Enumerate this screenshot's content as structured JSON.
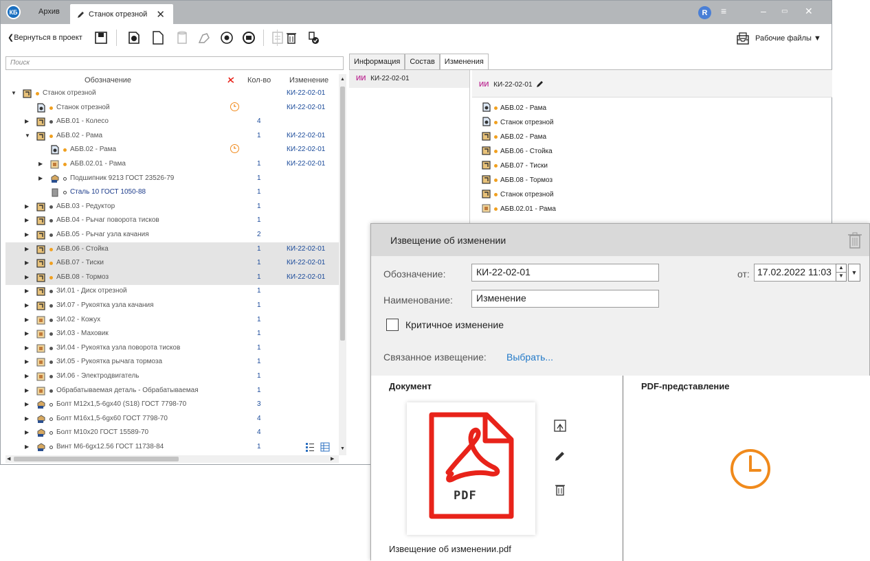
{
  "window": {
    "logo": "КБ",
    "tabs": [
      "Архив",
      "Станок отрезной"
    ],
    "user_initial": "R",
    "buttons": [
      "menu-icon",
      "minimize-icon",
      "restore-icon",
      "close-icon"
    ]
  },
  "toolbar": {
    "back_label": "Вернуться в проект",
    "workfiles_label": "Рабочие файлы ▼"
  },
  "left": {
    "search_placeholder": "Поиск",
    "columns": {
      "designation": "Обозначение",
      "qty": "Кол-во",
      "change": "Изменение"
    },
    "rows": [
      {
        "level": 0,
        "exp": "▼",
        "icon": "assembly",
        "dot": "#f0a020",
        "name": "Станок отрезной",
        "qty": "",
        "change": "КИ-22-02-01",
        "hl": false,
        "clock": false
      },
      {
        "level": 1,
        "exp": "",
        "icon": "drawing",
        "dot": "#f0a020",
        "name": "Станок отрезной",
        "qty": "",
        "change": "КИ-22-02-01",
        "hl": false,
        "clock": true
      },
      {
        "level": 1,
        "exp": "▶",
        "icon": "assembly",
        "dot": "#555",
        "name": "АБВ.01 - Колесо",
        "qty": "4",
        "change": "",
        "hl": false,
        "clock": false
      },
      {
        "level": 1,
        "exp": "▼",
        "icon": "assembly",
        "dot": "#f0a020",
        "name": "АБВ.02 - Рама",
        "qty": "1",
        "change": "КИ-22-02-01",
        "hl": false,
        "clock": false
      },
      {
        "level": 2,
        "exp": "",
        "icon": "drawing",
        "dot": "#f0a020",
        "name": "АБВ.02 - Рама",
        "qty": "",
        "change": "КИ-22-02-01",
        "hl": false,
        "clock": true
      },
      {
        "level": 2,
        "exp": "▶",
        "icon": "part",
        "dot": "#f0a020",
        "name": "АБВ.02.01 - Рама",
        "qty": "1",
        "change": "КИ-22-02-01",
        "hl": false,
        "clock": false
      },
      {
        "level": 2,
        "exp": "▶",
        "icon": "standard",
        "dot": "ring",
        "name": "Подшипник 9213 ГОСТ 23526-79",
        "qty": "1",
        "change": "",
        "hl": false,
        "clock": false
      },
      {
        "level": 2,
        "exp": "",
        "icon": "material",
        "dot": "ring",
        "name": "Сталь 10 ГОСТ 1050-88",
        "qty": "1",
        "change": "",
        "hl": false,
        "clock": false,
        "blue": true
      },
      {
        "level": 1,
        "exp": "▶",
        "icon": "assembly",
        "dot": "#555",
        "name": "АБВ.03 - Редуктор",
        "qty": "1",
        "change": "",
        "hl": false,
        "clock": false
      },
      {
        "level": 1,
        "exp": "▶",
        "icon": "assembly",
        "dot": "#555",
        "name": "АБВ.04 - Рычаг поворота тисков",
        "qty": "1",
        "change": "",
        "hl": false,
        "clock": false
      },
      {
        "level": 1,
        "exp": "▶",
        "icon": "assembly",
        "dot": "#555",
        "name": "АБВ.05 - Рычаг узла качания",
        "qty": "2",
        "change": "",
        "hl": false,
        "clock": false
      },
      {
        "level": 1,
        "exp": "▶",
        "icon": "assembly",
        "dot": "#f0a020",
        "name": "АБВ.06 - Стойка",
        "qty": "1",
        "change": "КИ-22-02-01",
        "hl": true,
        "clock": false
      },
      {
        "level": 1,
        "exp": "▶",
        "icon": "assembly",
        "dot": "#f0a020",
        "name": "АБВ.07 - Тиски",
        "qty": "1",
        "change": "КИ-22-02-01",
        "hl": true,
        "clock": false
      },
      {
        "level": 1,
        "exp": "▶",
        "icon": "assembly",
        "dot": "#f0a020",
        "name": "АБВ.08 - Тормоз",
        "qty": "1",
        "change": "КИ-22-02-01",
        "hl": true,
        "clock": false
      },
      {
        "level": 1,
        "exp": "▶",
        "icon": "assembly",
        "dot": "#555",
        "name": "ЗИ.01 - Диск отрезной",
        "qty": "1",
        "change": "",
        "hl": false,
        "clock": false
      },
      {
        "level": 1,
        "exp": "▶",
        "icon": "assembly",
        "dot": "#555",
        "name": "ЗИ.07 - Рукоятка узла качания",
        "qty": "1",
        "change": "",
        "hl": false,
        "clock": false
      },
      {
        "level": 1,
        "exp": "▶",
        "icon": "part",
        "dot": "#555",
        "name": "ЗИ.02 - Кожух",
        "qty": "1",
        "change": "",
        "hl": false,
        "clock": false
      },
      {
        "level": 1,
        "exp": "▶",
        "icon": "part",
        "dot": "#555",
        "name": "ЗИ.03 - Маховик",
        "qty": "1",
        "change": "",
        "hl": false,
        "clock": false
      },
      {
        "level": 1,
        "exp": "▶",
        "icon": "part",
        "dot": "#555",
        "name": "ЗИ.04 - Рукоятка узла поворота тисков",
        "qty": "1",
        "change": "",
        "hl": false,
        "clock": false
      },
      {
        "level": 1,
        "exp": "▶",
        "icon": "part",
        "dot": "#555",
        "name": "ЗИ.05 - Рукоятка рычага тормоза",
        "qty": "1",
        "change": "",
        "hl": false,
        "clock": false
      },
      {
        "level": 1,
        "exp": "▶",
        "icon": "part",
        "dot": "#555",
        "name": "ЗИ.06 - Электродвигатель",
        "qty": "1",
        "change": "",
        "hl": false,
        "clock": false
      },
      {
        "level": 1,
        "exp": "▶",
        "icon": "part",
        "dot": "#555",
        "name": "Обрабатываемая деталь - Обрабатываемая",
        "qty": "1",
        "change": "",
        "hl": false,
        "clock": false
      },
      {
        "level": 1,
        "exp": "▶",
        "icon": "standard",
        "dot": "ring",
        "name": "Болт М12х1,5-6gх40 (S18) ГОСТ 7798-70",
        "qty": "3",
        "change": "",
        "hl": false,
        "clock": false
      },
      {
        "level": 1,
        "exp": "▶",
        "icon": "standard",
        "dot": "ring",
        "name": "Болт М16х1,5-6gх60 ГОСТ 7798-70",
        "qty": "4",
        "change": "",
        "hl": false,
        "clock": false
      },
      {
        "level": 1,
        "exp": "▶",
        "icon": "standard",
        "dot": "ring",
        "name": "Болт М10х20 ГОСТ 15589-70",
        "qty": "4",
        "change": "",
        "hl": false,
        "clock": false
      },
      {
        "level": 1,
        "exp": "▶",
        "icon": "standard",
        "dot": "ring",
        "name": "Винт М6-6gх12.56 ГОСТ 11738-84",
        "qty": "1",
        "change": "",
        "hl": false,
        "clock": false
      }
    ]
  },
  "right": {
    "tabs": [
      "Информация",
      "Состав",
      "Изменения"
    ],
    "active_tab": 2,
    "prefix": "ИИ",
    "change_item": "КИ-22-02-01",
    "header_code": "КИ-22-02-01",
    "docs": [
      {
        "icon": "drawing",
        "name": "АБВ.02 - Рама"
      },
      {
        "icon": "drawing",
        "name": "Станок отрезной"
      },
      {
        "icon": "assembly",
        "name": "АБВ.02 - Рама"
      },
      {
        "icon": "assembly",
        "name": "АБВ.06 - Стойка"
      },
      {
        "icon": "assembly",
        "name": "АБВ.07 - Тиски"
      },
      {
        "icon": "assembly",
        "name": "АБВ.08 - Тормоз"
      },
      {
        "icon": "assembly",
        "name": "Станок отрезной"
      },
      {
        "icon": "part",
        "name": "АБВ.02.01 - Рама"
      }
    ]
  },
  "dialog": {
    "title": "Извещение об изменении",
    "designation_label": "Обозначение:",
    "designation_value": "КИ-22-02-01",
    "name_label": "Наименование:",
    "name_value": "Изменение",
    "from_label": "от:",
    "date_value": "17.02.2022 11:03",
    "critical_label": "Критичное изменение",
    "related_label": "Связанное извещение:",
    "related_link": "Выбрать...",
    "document_title": "Документ",
    "pdf_title": "PDF-представление",
    "file_name": "Извещение об изменении.pdf",
    "pdf_badge": "PDF"
  },
  "colors": {
    "accent_blue": "#1a4a9a",
    "link": "#2279c8",
    "orange": "#f08a1c",
    "pdf_red": "#e8231a"
  }
}
